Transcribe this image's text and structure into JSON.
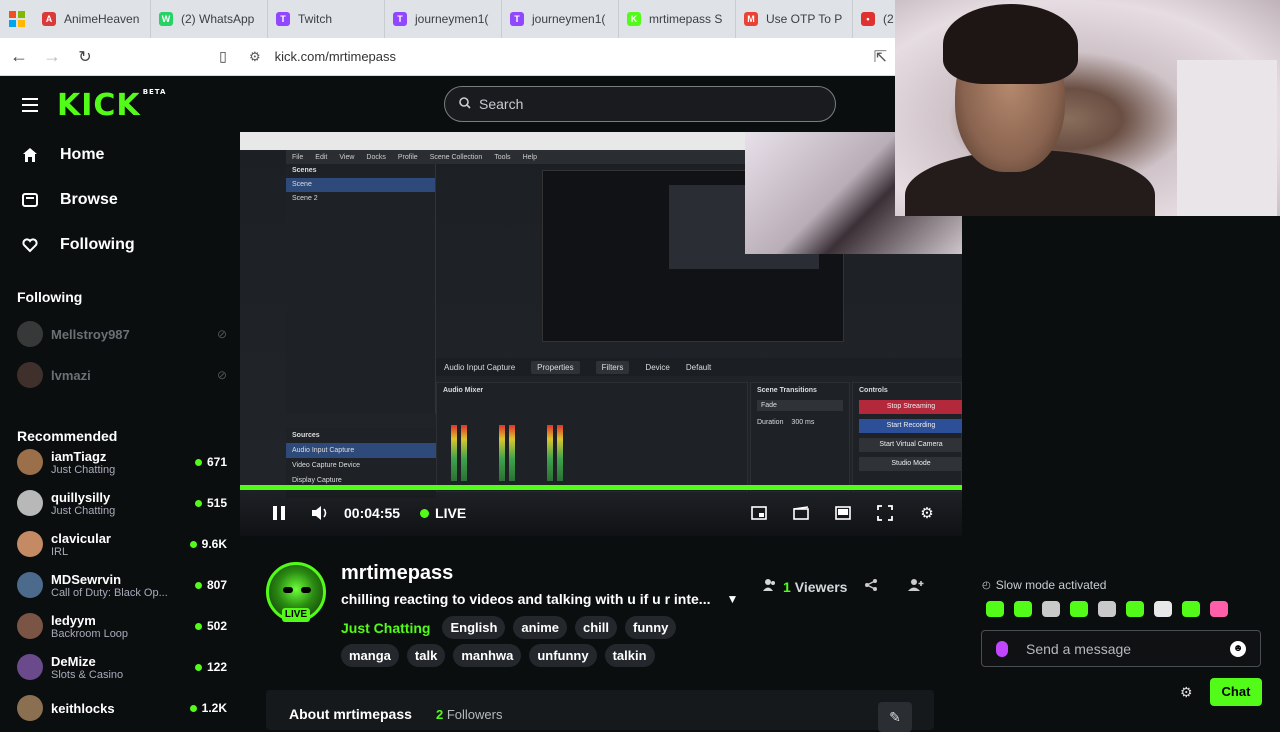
{
  "browser": {
    "tabs": [
      {
        "label": "AnimeHeaven",
        "color": "#d93a3a",
        "glyph": "A"
      },
      {
        "label": "(2) WhatsApp",
        "color": "#25d366",
        "glyph": "W"
      },
      {
        "label": "Twitch",
        "color": "#9146ff",
        "glyph": "T"
      },
      {
        "label": "journeymen1(",
        "color": "#9146ff",
        "glyph": "T"
      },
      {
        "label": "journeymen1(",
        "color": "#9146ff",
        "glyph": "T"
      },
      {
        "label": "mrtimepass S",
        "color": "#53fc18",
        "glyph": "K"
      },
      {
        "label": "Use OTP To P",
        "color": "#ea4335",
        "glyph": "M"
      },
      {
        "label": "(2",
        "color": "#e03131",
        "glyph": "•"
      }
    ],
    "url": "kick.com/mrtimepass"
  },
  "sidebar": {
    "logo": "KICK",
    "logo_badge": "BETA",
    "nav": [
      {
        "label": "Home"
      },
      {
        "label": "Browse"
      },
      {
        "label": "Following"
      }
    ],
    "following_heading": "Following",
    "following": [
      {
        "name": "Mellstroy987"
      },
      {
        "name": "lvmazi"
      }
    ],
    "recommended_heading": "Recommended",
    "recommended": [
      {
        "name": "iamTiagz",
        "category": "Just Chatting",
        "viewers": "671",
        "color": "#9b6f4a"
      },
      {
        "name": "quillysilly",
        "category": "Just Chatting",
        "viewers": "515",
        "color": "#b8b8b8"
      },
      {
        "name": "clavicular",
        "category": "IRL",
        "viewers": "9.6K",
        "color": "#c48a63"
      },
      {
        "name": "MDSewrvin",
        "category": "Call of Duty: Black Op...",
        "viewers": "807",
        "color": "#4c6a8c"
      },
      {
        "name": "ledyym",
        "category": "Backroom Loop",
        "viewers": "502",
        "color": "#7a5545"
      },
      {
        "name": "DeMize",
        "category": "Slots & Casino",
        "viewers": "122",
        "color": "#6a4a8a"
      },
      {
        "name": "keithlocks",
        "category": "",
        "viewers": "1.2K",
        "color": "#8a7050"
      }
    ]
  },
  "search": {
    "placeholder": "Search"
  },
  "player": {
    "time": "00:04:55",
    "live_label": "LIVE",
    "obs": {
      "menu": [
        "File",
        "Edit",
        "View",
        "Docks",
        "Profile",
        "Scene Collection",
        "Tools",
        "Help"
      ],
      "scenes_title": "Scenes",
      "scenes": [
        "Scene",
        "Scene 2"
      ],
      "sources_title": "Sources",
      "sources": [
        "Audio Input Capture",
        "Video Capture Device",
        "Display Capture"
      ],
      "bar": [
        "Audio Input Capture",
        "Properties",
        "Filters",
        "Device",
        "Default"
      ],
      "mixer_title": "Audio Mixer",
      "transitions_title": "Scene Transitions",
      "transition": "Fade",
      "duration_label": "Duration",
      "duration": "300 ms",
      "controls_title": "Controls",
      "controls": [
        "Stop Streaming",
        "Start Recording",
        "Start Virtual Camera",
        "Studio Mode",
        "Settings"
      ]
    }
  },
  "channel": {
    "name": "mrtimepass",
    "title": "chilling reacting to videos and talking with u if u r inte...",
    "live_badge": "LIVE",
    "category": "Just Chatting",
    "tags_row1": [
      "English",
      "anime",
      "chill",
      "funny"
    ],
    "tags_row2": [
      "manga",
      "talk",
      "manhwa",
      "unfunny",
      "talkin"
    ],
    "viewers_count": "1",
    "viewers_label": "Viewers",
    "about_title": "About mrtimepass",
    "followers_count": "2",
    "followers_label": "Followers"
  },
  "chat": {
    "slow_mode": "Slow mode activated",
    "placeholder": "Send a message",
    "button": "Chat"
  },
  "colors": {
    "accent": "#53fc18",
    "background": "#0b0e0f"
  }
}
